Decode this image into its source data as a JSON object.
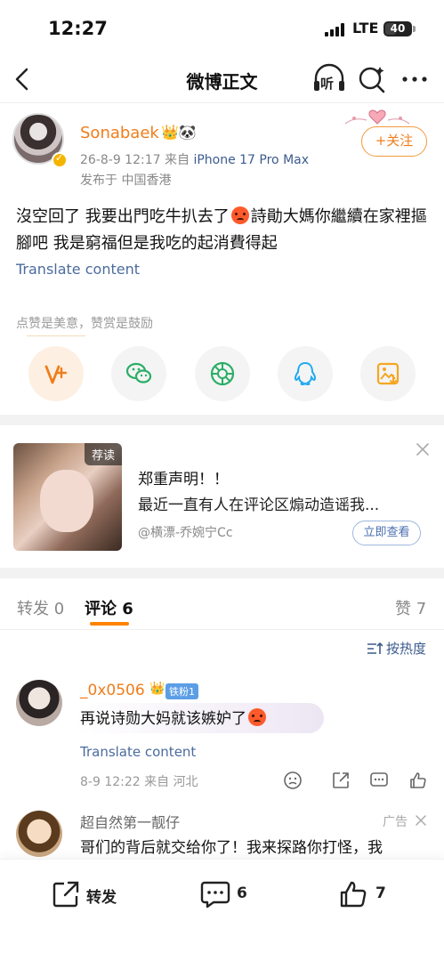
{
  "status_bar": {
    "time": "12:27",
    "network": "LTE",
    "battery": "40"
  },
  "nav": {
    "title": "微博正文",
    "listen_label": "听"
  },
  "post": {
    "username": "Sonabaek",
    "badges": "👑🐼",
    "date": "26-8-9 12:17",
    "source_prefix": "来自",
    "device": "iPhone 17 Pro Max",
    "location": "发布于 中国香港",
    "follow_label": "+关注",
    "text_before_emoji": "沒空回了 我要出門吃牛扒去了",
    "text_after_emoji": "詩勛大媽你繼續在家裡摳腳吧 我是窮福但是我吃的起消費得起",
    "translate": "Translate content",
    "reward_hint": "点赞是美意，赞赏是鼓励"
  },
  "share_icons": [
    "reward-icon",
    "wechat-icon",
    "moments-icon",
    "qq-icon",
    "save-image-icon"
  ],
  "promo": {
    "tag": "荐读",
    "title": "郑重声明！！",
    "desc": "最近一直有人在评论区煽动造谣我...",
    "source": "@横漂-乔婉宁Cc",
    "button": "立即查看"
  },
  "tabs": {
    "repost": "转发 0",
    "comments": "评论 6",
    "likes": "赞 7"
  },
  "sort_label": "按热度",
  "comments": [
    {
      "username": "_0x0506",
      "fan_badge": "铁粉1",
      "text": "再说诗勋大妈就该嫉妒了",
      "translate": "Translate content",
      "meta": "8-9 12:22 来自 河北"
    },
    {
      "username": "超自然第一靓仔",
      "ad": "广告",
      "text": "哥们的背后就交给你了！我来探路你打怪，我"
    }
  ],
  "bottom_bar": {
    "repost": "转发",
    "comments": "6",
    "likes": "7"
  },
  "colors": {
    "accent": "#ff8200",
    "username": "#f07d1b",
    "link": "#4b6b9e"
  }
}
